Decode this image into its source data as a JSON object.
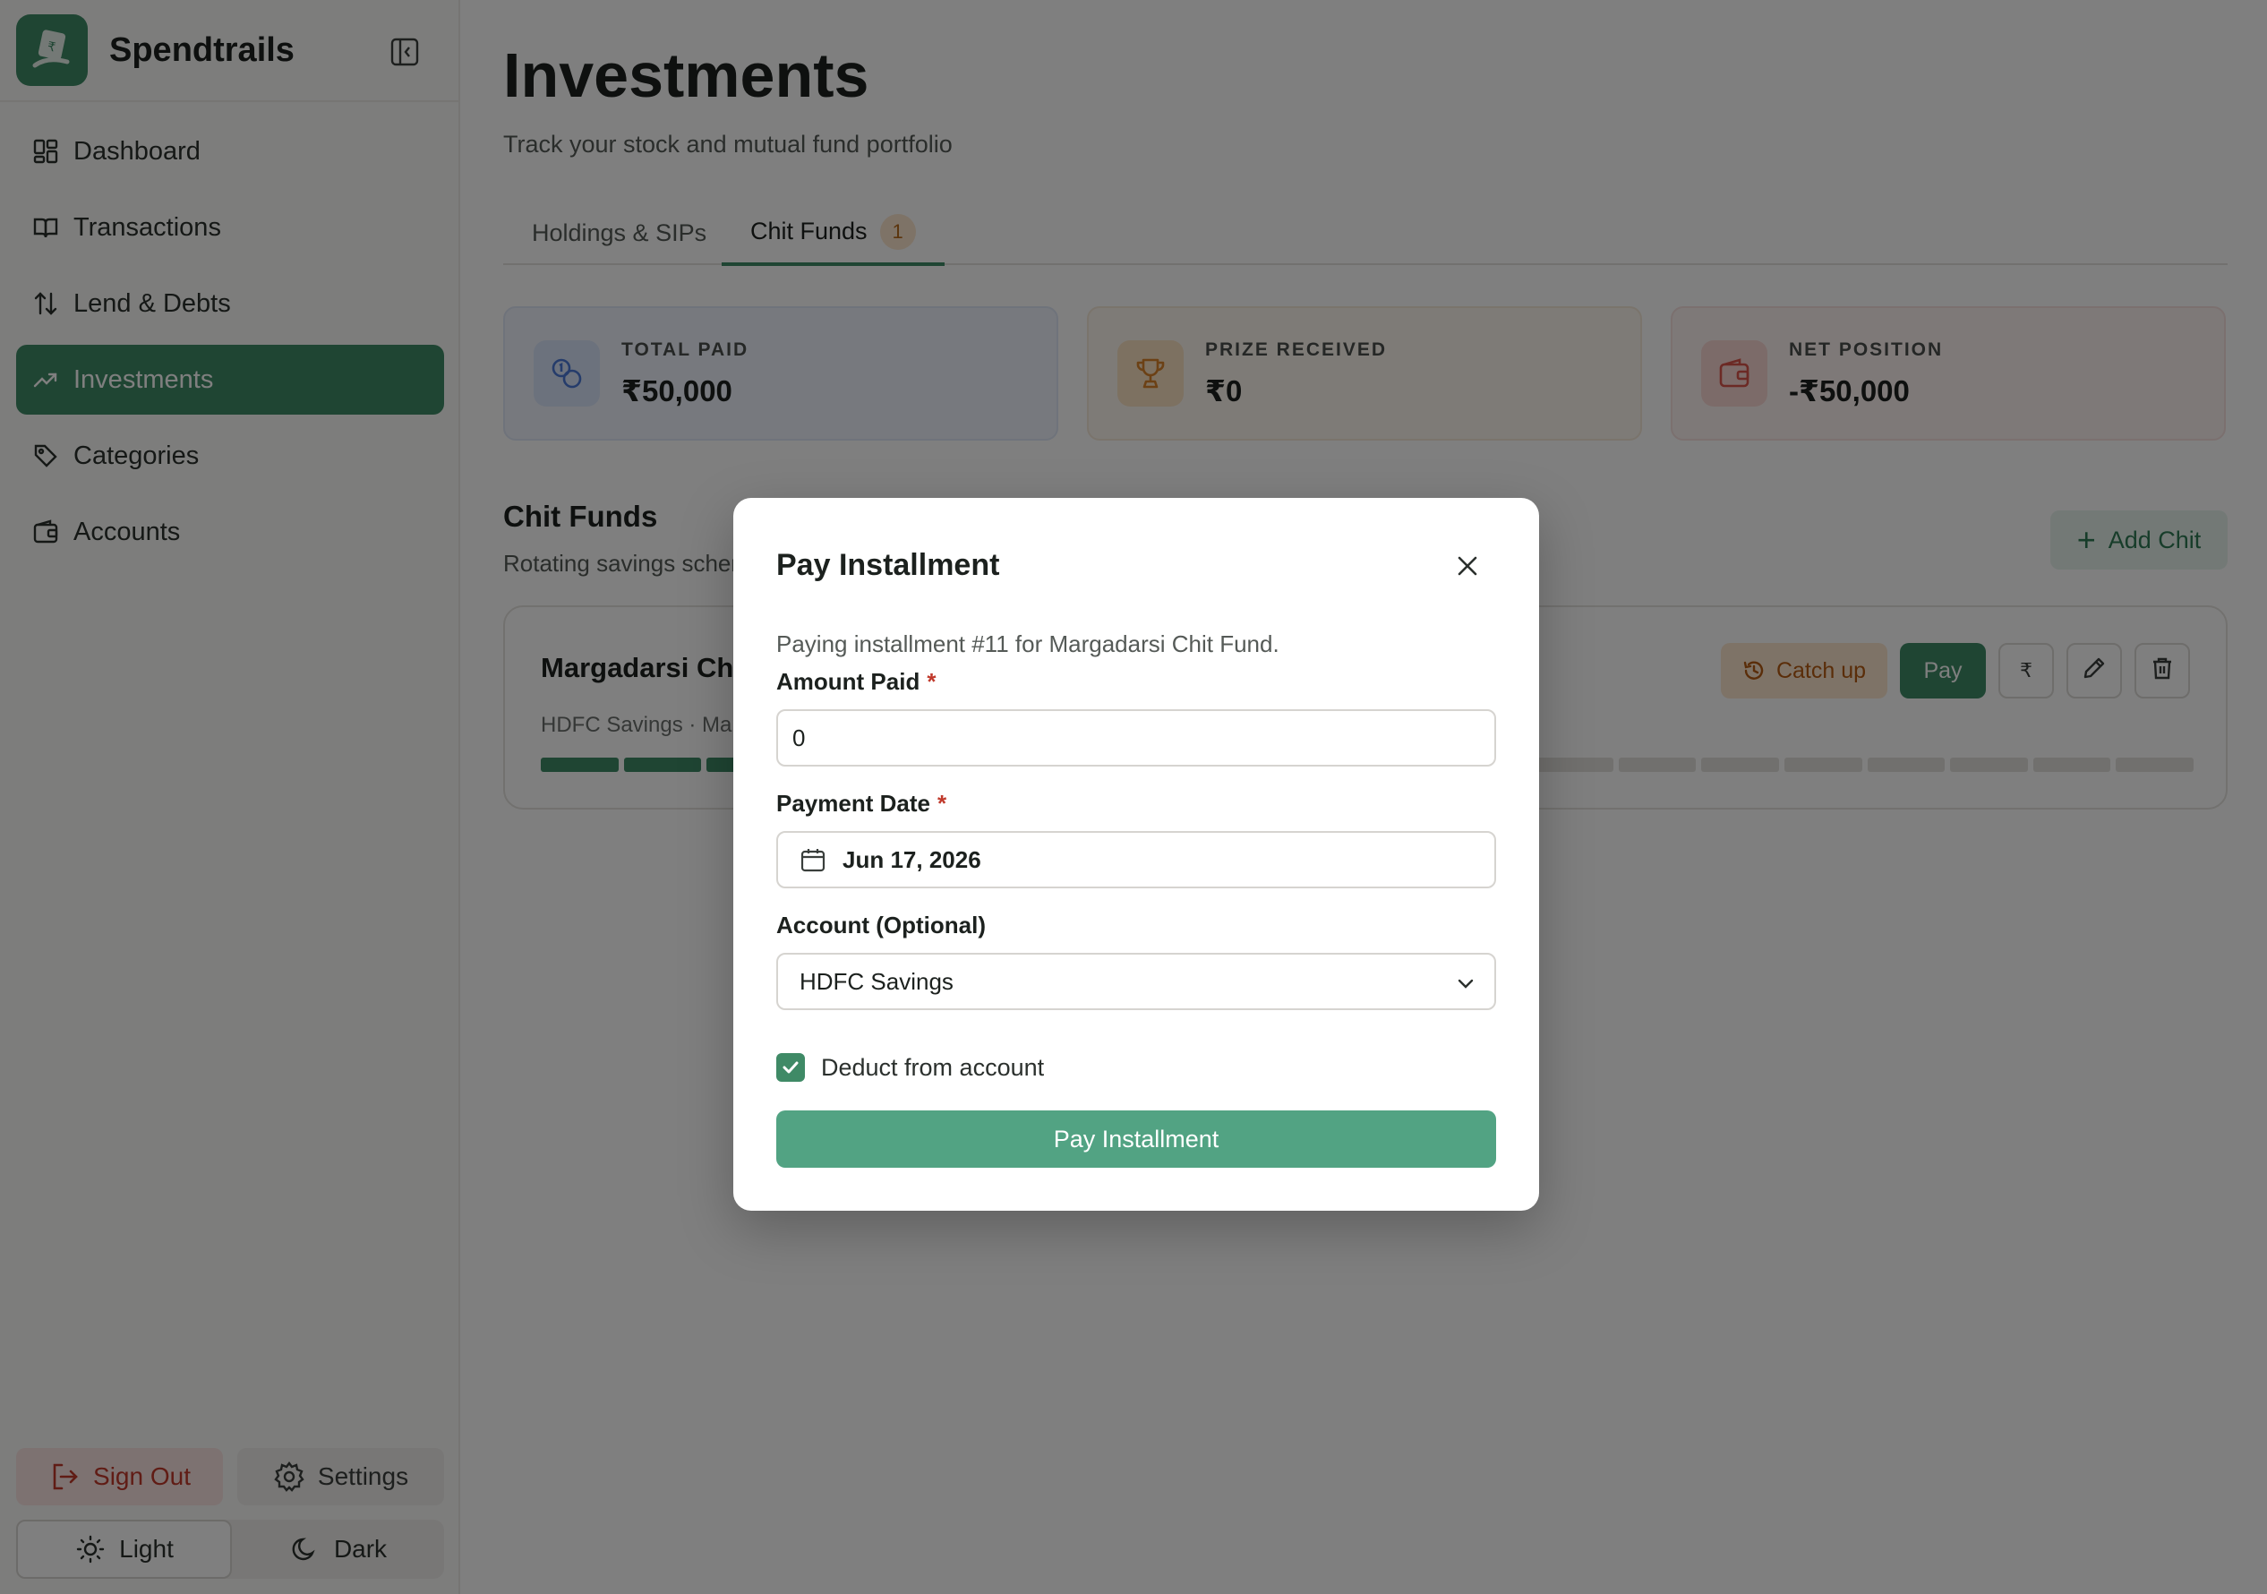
{
  "app": {
    "name": "Spendtrails",
    "logo_icon": "rupee-note-icon",
    "accent_color": "#3f8a66"
  },
  "sidebar": {
    "items": [
      {
        "label": "Dashboard",
        "icon": "dashboard-icon",
        "active": false
      },
      {
        "label": "Transactions",
        "icon": "book-icon",
        "active": false
      },
      {
        "label": "Lend & Debts",
        "icon": "arrows-up-down-icon",
        "active": false
      },
      {
        "label": "Investments",
        "icon": "trending-up-icon",
        "active": true
      },
      {
        "label": "Categories",
        "icon": "tag-icon",
        "active": false
      },
      {
        "label": "Accounts",
        "icon": "wallet-icon",
        "active": false
      }
    ],
    "sign_out": "Sign Out",
    "settings": "Settings",
    "theme_light": "Light",
    "theme_dark": "Dark"
  },
  "page": {
    "title": "Investments",
    "subtitle": "Track your stock and mutual fund portfolio",
    "tabs": [
      {
        "label": "Holdings & SIPs",
        "active": false
      },
      {
        "label": "Chit Funds",
        "active": true,
        "badge": "1"
      }
    ]
  },
  "stats": [
    {
      "label": "TOTAL PAID",
      "value": "₹50,000",
      "icon": "coins-icon",
      "color": "#4a78d6"
    },
    {
      "label": "PRIZE RECEIVED",
      "value": "₹0",
      "icon": "trophy-icon",
      "color": "#d9822b"
    },
    {
      "label": "NET POSITION",
      "value": "-₹50,000",
      "icon": "wallet-icon",
      "color": "#d9544a"
    }
  ],
  "chit_section": {
    "title": "Chit Funds",
    "subtitle": "Rotating savings scher",
    "add_button": "Add Chit"
  },
  "chit_card": {
    "name": "Margadarsi Chit",
    "meta": "HDFC Savings · Marg",
    "installments_paid": 10,
    "installments_total": 20,
    "catch_up": "Catch up",
    "pay": "Pay",
    "rupee_symbol": "₹"
  },
  "modal": {
    "title": "Pay Installment",
    "description": "Paying installment #11 for Margadarsi Chit Fund.",
    "amount_label": "Amount Paid",
    "amount_value": "0",
    "date_label": "Payment Date",
    "date_value": "Jun 17, 2026",
    "account_label": "Account (Optional)",
    "account_value": "HDFC Savings",
    "deduct_label": "Deduct from account",
    "deduct_checked": true,
    "submit": "Pay Installment",
    "required_mark": "*"
  }
}
